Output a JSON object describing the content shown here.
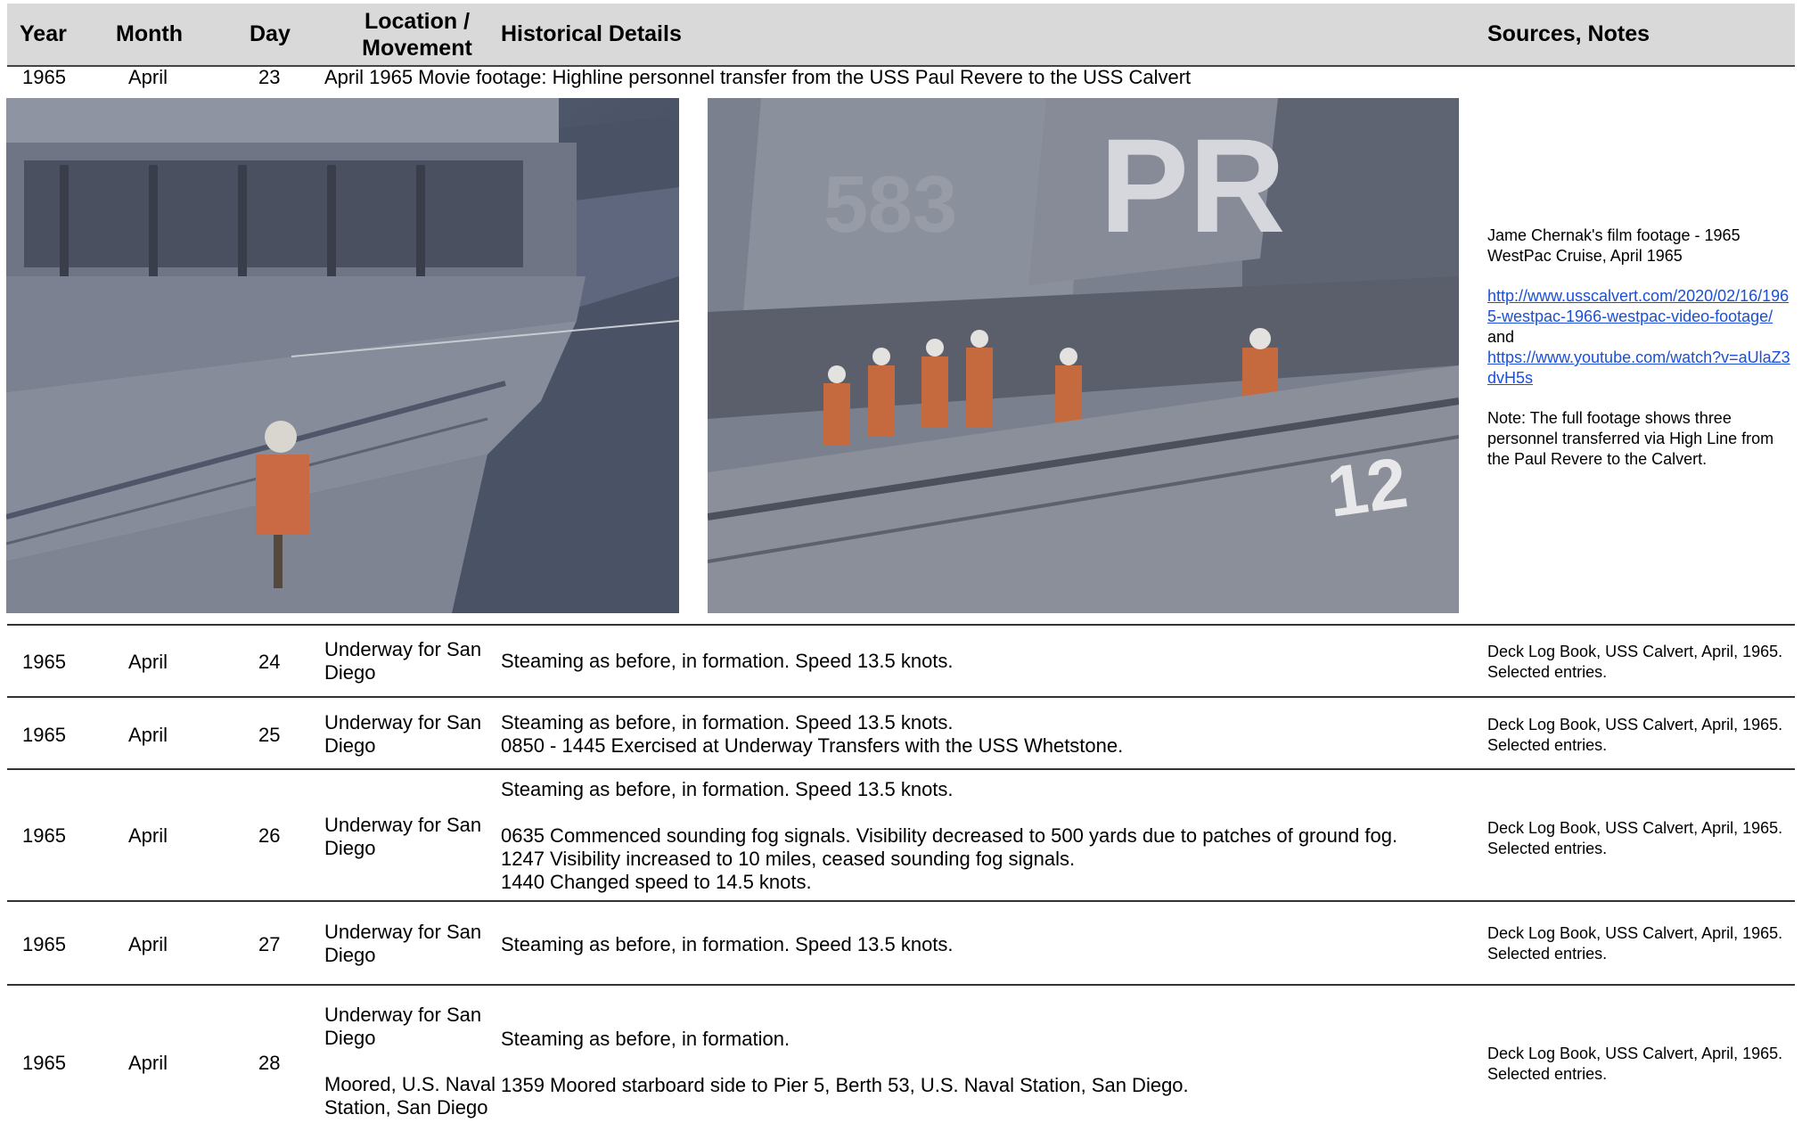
{
  "header": {
    "year": "Year",
    "month": "Month",
    "day": "Day",
    "location_line1": "Location /",
    "location_line2": "Movement",
    "details": "Historical Details",
    "sources": "Sources, Notes"
  },
  "rows": [
    {
      "year": "1965",
      "month": "April",
      "day": "23",
      "details": [
        "April 1965 Movie footage: Highline personnel transfer from the USS Paul Revere to the USS Calvert"
      ],
      "sources": {
        "title": "Jame Chernak's film footage - 1965 WestPac Cruise, April 1965",
        "link1": "http://www.usscalvert.com/2020/02/16/1965-westpac-1966-westpac-video-footage/",
        "and": "and",
        "link2": "https://www.youtube.com/watch?v=aUlaZ3dvH5s",
        "note": "Note: The full footage shows three personnel transferred via High Line from the Paul Revere to the Calvert."
      },
      "photos": [
        "photo-highline-transfer-left",
        "photo-paul-revere-pr-hull"
      ]
    },
    {
      "year": "1965",
      "month": "April",
      "day": "24",
      "location": [
        "Underway for San",
        "Diego"
      ],
      "details": [
        "Steaming as before, in formation. Speed 13.5 knots."
      ],
      "sources": [
        "Deck Log Book, USS Calvert, April, 1965.",
        "Selected entries."
      ]
    },
    {
      "year": "1965",
      "month": "April",
      "day": "25",
      "location": [
        "Underway for San",
        "Diego"
      ],
      "details": [
        "Steaming as before, in formation. Speed 13.5 knots.",
        "0850 - 1445 Exercised at Underway Transfers with the USS Whetstone."
      ],
      "sources": [
        "Deck Log Book, USS Calvert, April, 1965.",
        "Selected entries."
      ]
    },
    {
      "year": "1965",
      "month": "April",
      "day": "26",
      "location": [
        "Underway for San",
        "Diego"
      ],
      "details": [
        "Steaming as before, in formation. Speed 13.5 knots.",
        "0635 Commenced sounding fog signals. Visibility decreased to 500 yards due to patches of ground fog.",
        "1247 Visibility increased to 10 miles, ceased sounding fog signals.",
        "1440 Changed speed to 14.5 knots."
      ],
      "sources": [
        "Deck Log Book, USS Calvert, April, 1965.",
        "Selected entries."
      ]
    },
    {
      "year": "1965",
      "month": "April",
      "day": "27",
      "location": [
        "Underway for San",
        "Diego"
      ],
      "details": [
        "Steaming as before, in formation. Speed 13.5 knots."
      ],
      "sources": [
        "Deck Log Book, USS Calvert, April, 1965.",
        "Selected entries."
      ]
    },
    {
      "year": "1965",
      "month": "April",
      "day": "28",
      "location": [
        "Underway for San",
        "Diego",
        "Moored, U.S. Naval",
        "Station, San Diego"
      ],
      "details": [
        "Steaming as before, in formation.",
        "1359 Moored starboard side to Pier 5, Berth 53, U.S. Naval Station, San Diego."
      ],
      "sources": [
        "Deck Log Book, USS Calvert, April, 1965.",
        "Selected entries."
      ]
    }
  ],
  "photo_text": {
    "hull_letters": "PR",
    "hull_number": "12",
    "bow_number": "583"
  },
  "colors": {
    "header_bg": "#d9d9d9",
    "link": "#1a4fd6",
    "rule": "#333333"
  }
}
